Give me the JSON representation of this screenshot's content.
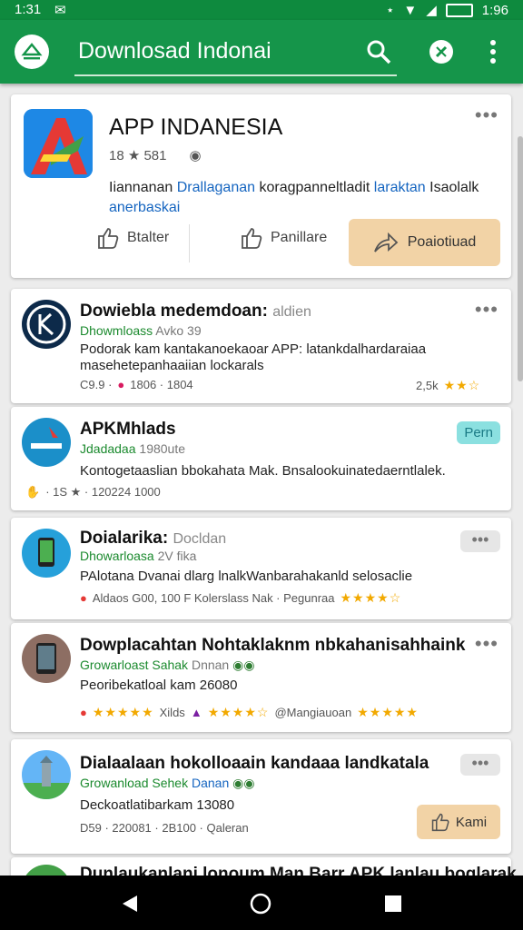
{
  "status": {
    "time": "1:31",
    "battery": "1:96"
  },
  "appbar": {
    "title": "Downlosad Indonai"
  },
  "hero": {
    "title": "APP INDANESIA",
    "meta": "18 ★ 581",
    "desc_plain": "Iiannanan ",
    "desc_blue1": "Drallaganan",
    "desc_mid": " koragpanneltladit ",
    "desc_blue2": "laraktan",
    "desc_end": " Isaolalk",
    "desc_line2": "anerbaskai",
    "btn1": "Btalter",
    "btn2": "Panillare",
    "btn3": "Poaiotiuad"
  },
  "items": [
    {
      "title": "Dowiebla medemdoan:",
      "title_soft": "aldien",
      "sub": "Dhowmloass",
      "sub_gray": "Avko 39",
      "desc": "Podorak kam kantakanoekaoar APP: latankdalhardaraiaa",
      "desc2": "masehetepanhaaiian lockarals",
      "foot_left": "C9.9 ·",
      "foot_mid": "1806 · 1804",
      "foot_right": "2,5k"
    },
    {
      "title": "APKMhlads",
      "sub": "Jdadadaa",
      "sub_gray": "1980ute",
      "desc": "Kontogetaaslian bbokahata Mak. Bnsalookuinatedaerntlalek.",
      "foot": "· 1S ★ · 120224 1000",
      "tag": "Pern"
    },
    {
      "title": "Doialarika:",
      "title_soft": "Docldan",
      "sub": "Dhowarloasa",
      "sub_gray": "2V fika",
      "desc": "PAlotana Dvanai dlarg lnalkWanbarahakanld selosaclie",
      "foot": "Aldaos G00, 100 F Kolerslass Nak · Pegunraa"
    },
    {
      "title": "Dowplacahtan Nohtaklaknm nbkahanisahhaink",
      "sub": "Growarloast Sahak",
      "sub_gray": "Dnnan",
      "desc": "Peoribekatloal kam 26080",
      "foot_a": "Xilds",
      "foot_b": "@Mangiauoan"
    },
    {
      "title": "Dialaalaan hokolloaain kandaaa landkatala",
      "sub": "Growanload Sehek",
      "sub_blue": "Danan",
      "desc": "Deckoatlatibarkam 13080",
      "foot": "D59 · 220081 · 2B100 · Qaleran",
      "btn": "Kami"
    },
    {
      "title": "Dunlaukanlani lonoum Man Barr APK lanlau boglarak"
    }
  ],
  "colors": {
    "appbar": "#15954a",
    "status": "#0e8a3e",
    "accent_button": "#f2d3a6"
  }
}
